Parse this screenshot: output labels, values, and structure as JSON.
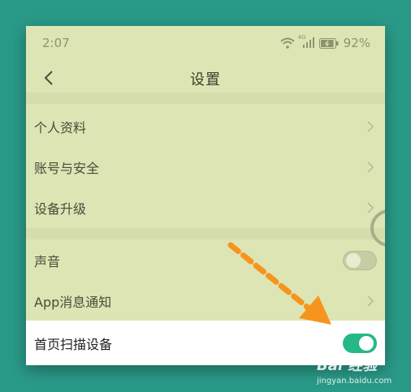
{
  "status_bar": {
    "time": "2:07",
    "network_label": "4G",
    "battery_text": "92%",
    "battery_level": 0.92
  },
  "header": {
    "title": "设置",
    "back_icon": "chevron-left-icon"
  },
  "settings": {
    "items": [
      {
        "label": "个人资料",
        "control": "chevron"
      },
      {
        "label": "账号与安全",
        "control": "chevron"
      },
      {
        "label": "设备升级",
        "control": "chevron"
      },
      {
        "label": "声音",
        "control": "toggle",
        "on": false
      },
      {
        "label": "App消息通知",
        "control": "chevron"
      },
      {
        "label": "首页扫描设备",
        "control": "toggle",
        "on": true
      }
    ]
  },
  "colors": {
    "background": "#2a9a88",
    "screen": "#dde5b4",
    "toggle_on": "#25b985",
    "arrow": "#f7941d"
  },
  "watermark": {
    "brand": "Bai 经验",
    "url": "jingyan.baidu.com"
  }
}
